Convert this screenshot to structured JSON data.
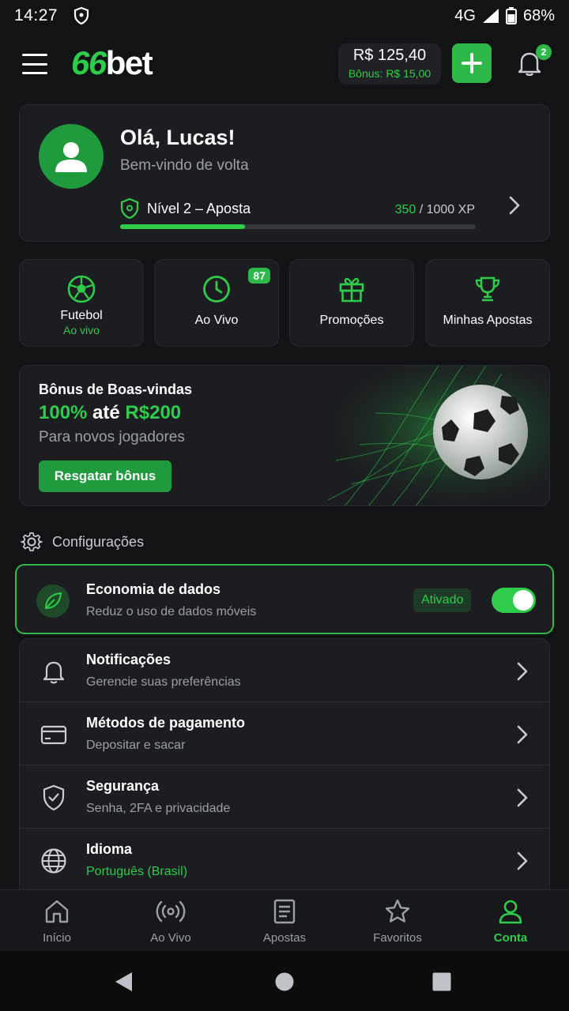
{
  "status": {
    "time": "14:27",
    "network": "4G",
    "battery": "68%"
  },
  "header": {
    "logo_num": "66",
    "logo_text": "bet",
    "balance": "R$ 125,40",
    "bonus": "Bônus: R$ 15,00",
    "notifications_count": "2"
  },
  "profile": {
    "greeting": "Olá, Lucas!",
    "subtitle": "Bem-vindo de volta",
    "level": "Nível 2 – Aposta",
    "xp_current": "350",
    "xp_total": "/ 1000 XP",
    "xp_progress": 0.35
  },
  "quick": [
    {
      "label": "Futebol",
      "sub": "Ao vivo",
      "icon": "soccer-ball-icon"
    },
    {
      "label": "Ao Vivo",
      "count": "87",
      "icon": "clock-icon"
    },
    {
      "label": "Promoções",
      "icon": "gift-icon"
    },
    {
      "label": "Minhas Apostas",
      "icon": "trophy-icon"
    }
  ],
  "banner": {
    "title": "Bônus de Boas-vindas",
    "headline_a": "100%",
    "headline_b": " até ",
    "headline_c": "R$200",
    "subtitle": "Para novos jogadores",
    "cta": "Resgatar bônus"
  },
  "settings": {
    "section_title": "Configurações",
    "data_saver": {
      "title": "Economia de dados",
      "desc": "Reduz o uso de dados móveis",
      "state": "Ativado",
      "enabled": true
    },
    "items": [
      {
        "title": "Notificações",
        "desc": "Gerencie suas preferências"
      },
      {
        "title": "Métodos de pagamento",
        "desc": "Depositar e sacar"
      },
      {
        "title": "Segurança",
        "desc": "Senha, 2FA e privacidade"
      },
      {
        "title": "Idioma",
        "desc": "Português (Brasil)"
      }
    ]
  },
  "nav": [
    {
      "label": "Início"
    },
    {
      "label": "Ao Vivo"
    },
    {
      "label": "Apostas"
    },
    {
      "label": "Favoritos"
    },
    {
      "label": "Conta",
      "active": true
    }
  ],
  "colors": {
    "accent": "#2ecc4a",
    "background": "#121315",
    "card": "#1b1d20"
  }
}
